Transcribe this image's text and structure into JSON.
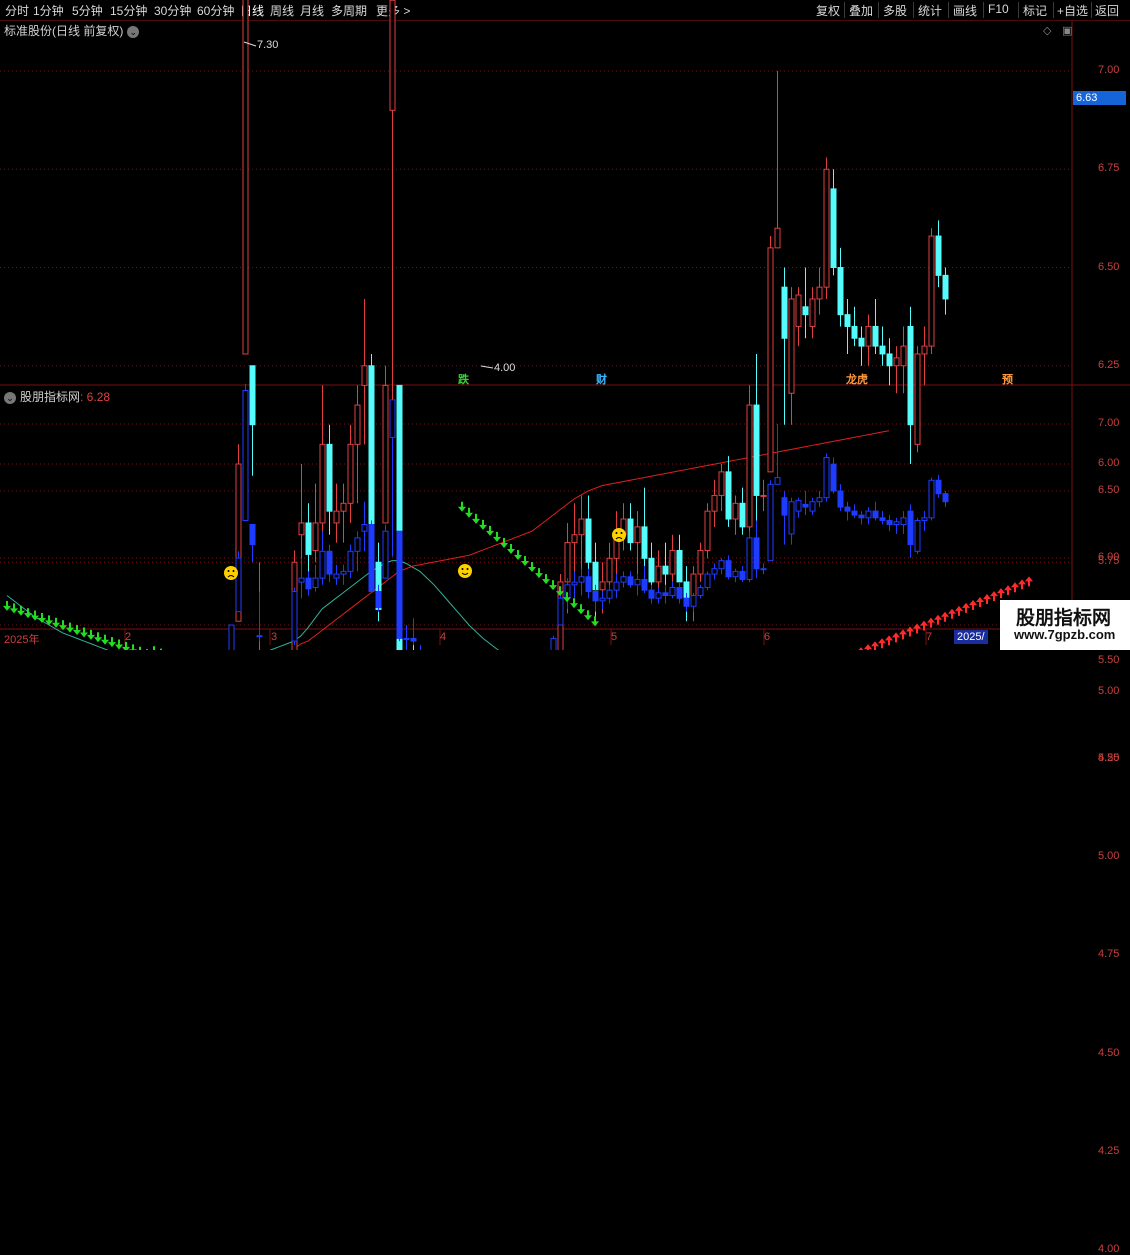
{
  "toolbar": {
    "timeframes": [
      "分时",
      "1分钟",
      "5分钟",
      "15分钟",
      "30分钟",
      "60分钟",
      "日线",
      "周线",
      "月线",
      "多周期",
      "更多 >"
    ],
    "actions": [
      "复权",
      "叠加",
      "多股",
      "统计",
      "画线",
      "F10",
      "标记",
      "+自选",
      "返回"
    ]
  },
  "main_panel": {
    "title": "标准股份(日线 前复权)",
    "current_price": "6.63",
    "high_label": "7.30",
    "low_label": "4.00",
    "y_ticks": [
      "7.00",
      "6.75",
      "6.50",
      "6.25",
      "6.00",
      "5.75",
      "5.50",
      "5.25",
      "5.00",
      "4.75",
      "4.50",
      "4.25",
      "4.00"
    ],
    "events": [
      {
        "label": "跌",
        "color": "#36d336"
      },
      {
        "label": "财",
        "color": "#39b8ff"
      },
      {
        "label": "龙虎",
        "color": "#ff9a3c"
      },
      {
        "label": "预",
        "color": "#ff9a3c"
      }
    ]
  },
  "indicator_panel": {
    "title": "股朋指标网",
    "value": ": 6.28",
    "y_ticks": [
      "7.00",
      "6.50",
      "6.00",
      "5.50",
      "5.00",
      "4.50"
    ]
  },
  "x_axis": {
    "labels": [
      "2025年",
      "2",
      "3",
      "4",
      "5",
      "6",
      "7"
    ],
    "date_tag": "2025/"
  },
  "watermark": {
    "line1": "股朋指标网",
    "line2": "www.7gpzb.com"
  },
  "colors": {
    "up": "#e14040",
    "down": "#54fcfc",
    "ind_up": "#ffff00",
    "ind_down": "#1e3cff",
    "buy_arrow": "#ff2a2a",
    "sell_arrow": "#22dd22",
    "grid": "#7a1111"
  },
  "chart_data": {
    "type": "candlestick",
    "ylim": [
      4.0,
      7.3
    ],
    "candles": [
      [
        4.55,
        4.65,
        4.45,
        4.55
      ],
      [
        4.6,
        4.7,
        4.5,
        4.62
      ],
      [
        4.6,
        4.65,
        4.45,
        4.5
      ],
      [
        4.5,
        4.75,
        4.45,
        4.7
      ],
      [
        4.68,
        4.72,
        4.55,
        4.58
      ],
      [
        4.48,
        4.62,
        4.35,
        4.45
      ],
      [
        4.52,
        4.82,
        4.48,
        4.78
      ],
      [
        4.8,
        4.92,
        4.75,
        4.88
      ],
      [
        4.9,
        4.96,
        4.82,
        4.86
      ],
      [
        4.88,
        4.95,
        4.8,
        4.92
      ],
      [
        4.84,
        4.92,
        4.8,
        4.86
      ],
      [
        4.82,
        4.98,
        4.78,
        4.96
      ],
      [
        4.95,
        5.02,
        4.85,
        4.9
      ],
      [
        4.9,
        4.98,
        4.8,
        4.82
      ],
      [
        4.82,
        4.92,
        4.72,
        4.78
      ],
      [
        4.78,
        4.98,
        4.75,
        4.95
      ],
      [
        4.92,
        4.98,
        4.8,
        4.88
      ],
      [
        4.8,
        4.86,
        4.74,
        4.8
      ],
      [
        4.84,
        4.96,
        4.8,
        4.92
      ],
      [
        4.92,
        4.99,
        4.86,
        4.95
      ],
      [
        4.98,
        5.02,
        4.92,
        4.96
      ],
      [
        4.95,
        5.04,
        4.92,
        5.02
      ],
      [
        4.98,
        5.03,
        4.96,
        5.0
      ],
      [
        5.0,
        5.1,
        4.98,
        5.08
      ],
      [
        5.08,
        5.14,
        5.0,
        5.06
      ],
      [
        5.1,
        5.12,
        5.02,
        5.05
      ],
      [
        5.04,
        5.1,
        4.98,
        5.08
      ],
      [
        5.08,
        5.12,
        4.98,
        5.0
      ],
      [
        4.98,
        5.06,
        4.96,
        5.05
      ],
      [
        5.05,
        5.1,
        4.98,
        5.02
      ],
      [
        5.02,
        5.1,
        4.98,
        5.08
      ],
      [
        5.08,
        5.12,
        4.98,
        5.0
      ],
      [
        5.0,
        5.5,
        4.98,
        5.5
      ],
      [
        5.6,
        6.05,
        5.6,
        6.0
      ],
      [
        6.28,
        7.3,
        6.28,
        7.25
      ],
      [
        6.25,
        6.1,
        5.97,
        6.1
      ],
      [
        5.42,
        5.75,
        5.38,
        5.42
      ],
      [
        5.02,
        5.08,
        4.98,
        5.06
      ],
      [
        5.0,
        5.05,
        4.98,
        5.02
      ],
      [
        5.02,
        5.12,
        5.0,
        5.1
      ],
      [
        5.1,
        5.2,
        5.05,
        5.15
      ],
      [
        5.38,
        5.78,
        5.35,
        5.75
      ],
      [
        5.82,
        6.0,
        5.7,
        5.85
      ],
      [
        5.85,
        5.9,
        5.72,
        5.77
      ],
      [
        5.78,
        5.95,
        5.75,
        5.85
      ],
      [
        5.85,
        6.2,
        5.8,
        6.05
      ],
      [
        6.05,
        6.1,
        5.82,
        5.88
      ],
      [
        5.85,
        5.95,
        5.8,
        5.88
      ],
      [
        5.88,
        5.95,
        5.8,
        5.9
      ],
      [
        5.9,
        6.1,
        5.85,
        6.05
      ],
      [
        6.05,
        6.2,
        5.9,
        6.15
      ],
      [
        6.2,
        6.42,
        6.05,
        6.25
      ],
      [
        6.25,
        6.28,
        5.75,
        5.75
      ],
      [
        5.75,
        5.8,
        5.6,
        5.63
      ],
      [
        5.85,
        6.25,
        5.85,
        6.2
      ],
      [
        6.9,
        7.18,
        6.01,
        7.18
      ],
      [
        6.2,
        6.2,
        5.38,
        5.4
      ],
      [
        5.4,
        5.5,
        5.3,
        5.4
      ],
      [
        5.4,
        5.55,
        5.35,
        5.38
      ],
      [
        5.3,
        5.35,
        5.25,
        5.27
      ],
      [
        4.85,
        4.9,
        4.7,
        4.78
      ],
      [
        4.6,
        4.65,
        4.0,
        4.46
      ],
      [
        4.45,
        4.65,
        4.42,
        4.6
      ],
      [
        4.58,
        4.82,
        4.55,
        4.8
      ],
      [
        4.8,
        4.9,
        4.72,
        4.85
      ],
      [
        4.88,
        5.0,
        4.85,
        4.98
      ],
      [
        4.95,
        5.05,
        4.9,
        5.0
      ],
      [
        5.0,
        5.05,
        4.92,
        4.98
      ],
      [
        4.95,
        5.02,
        4.85,
        4.9
      ],
      [
        4.85,
        4.95,
        4.75,
        4.88
      ],
      [
        4.88,
        4.98,
        4.82,
        4.95
      ],
      [
        4.95,
        5.05,
        4.9,
        5.0
      ],
      [
        5.0,
        5.08,
        4.95,
        5.02
      ],
      [
        5.02,
        5.08,
        4.95,
        5.0
      ],
      [
        5.0,
        5.05,
        4.95,
        4.98
      ],
      [
        4.98,
        5.02,
        4.92,
        5.0
      ],
      [
        5.0,
        5.08,
        4.98,
        5.05
      ],
      [
        5.05,
        5.25,
        5.02,
        5.2
      ],
      [
        5.2,
        5.42,
        5.18,
        5.4
      ],
      [
        5.5,
        5.72,
        5.5,
        5.7
      ],
      [
        5.7,
        5.85,
        5.62,
        5.8
      ],
      [
        5.8,
        5.9,
        5.7,
        5.82
      ],
      [
        5.82,
        5.92,
        5.72,
        5.86
      ],
      [
        5.86,
        5.92,
        5.7,
        5.75
      ],
      [
        5.75,
        5.8,
        5.6,
        5.68
      ],
      [
        5.68,
        5.75,
        5.62,
        5.7
      ],
      [
        5.7,
        5.8,
        5.66,
        5.76
      ],
      [
        5.76,
        5.88,
        5.7,
        5.82
      ],
      [
        5.82,
        5.9,
        5.78,
        5.86
      ],
      [
        5.86,
        5.9,
        5.78,
        5.8
      ],
      [
        5.8,
        5.88,
        5.72,
        5.84
      ],
      [
        5.84,
        5.94,
        5.74,
        5.76
      ],
      [
        5.76,
        5.8,
        5.66,
        5.7
      ],
      [
        5.7,
        5.78,
        5.66,
        5.74
      ],
      [
        5.74,
        5.8,
        5.66,
        5.72
      ],
      [
        5.72,
        5.82,
        5.7,
        5.78
      ],
      [
        5.78,
        5.82,
        5.66,
        5.7
      ],
      [
        5.7,
        5.74,
        5.6,
        5.64
      ],
      [
        5.64,
        5.74,
        5.6,
        5.72
      ],
      [
        5.72,
        5.8,
        5.7,
        5.78
      ],
      [
        5.78,
        5.9,
        5.76,
        5.88
      ],
      [
        5.88,
        5.96,
        5.84,
        5.92
      ],
      [
        5.92,
        6.0,
        5.88,
        5.98
      ],
      [
        5.98,
        6.02,
        5.84,
        5.86
      ],
      [
        5.86,
        5.92,
        5.82,
        5.9
      ],
      [
        5.9,
        5.94,
        5.82,
        5.84
      ],
      [
        5.84,
        6.2,
        5.82,
        6.15
      ],
      [
        6.15,
        6.28,
        5.85,
        5.92
      ],
      [
        5.92,
        5.96,
        5.88,
        5.92
      ],
      [
        5.98,
        6.58,
        5.98,
        6.55
      ],
      [
        6.55,
        7.0,
        6.55,
        6.6
      ],
      [
        6.45,
        6.5,
        6.1,
        6.32
      ],
      [
        6.18,
        6.45,
        6.1,
        6.42
      ],
      [
        6.35,
        6.45,
        6.3,
        6.43
      ],
      [
        6.4,
        6.5,
        6.32,
        6.38
      ],
      [
        6.35,
        6.45,
        6.32,
        6.42
      ],
      [
        6.42,
        6.5,
        6.38,
        6.45
      ],
      [
        6.45,
        6.78,
        6.42,
        6.75
      ],
      [
        6.7,
        6.75,
        6.48,
        6.5
      ],
      [
        6.5,
        6.55,
        6.35,
        6.38
      ],
      [
        6.38,
        6.42,
        6.28,
        6.35
      ],
      [
        6.35,
        6.4,
        6.3,
        6.32
      ],
      [
        6.32,
        6.35,
        6.25,
        6.3
      ],
      [
        6.3,
        6.38,
        6.25,
        6.35
      ],
      [
        6.35,
        6.42,
        6.28,
        6.3
      ],
      [
        6.3,
        6.35,
        6.25,
        6.28
      ],
      [
        6.28,
        6.32,
        6.2,
        6.25
      ],
      [
        6.25,
        6.3,
        6.18,
        6.27
      ],
      [
        6.25,
        6.35,
        6.18,
        6.3
      ],
      [
        6.35,
        6.4,
        6.0,
        6.1
      ],
      [
        6.05,
        6.3,
        6.03,
        6.28
      ],
      [
        6.28,
        6.35,
        6.2,
        6.3
      ],
      [
        6.3,
        6.6,
        6.28,
        6.58
      ],
      [
        6.58,
        6.62,
        6.45,
        6.48
      ],
      [
        6.48,
        6.5,
        6.38,
        6.42
      ]
    ],
    "ma_upper": [
      5.72,
      5.68,
      5.64,
      5.6,
      5.56,
      5.53,
      5.5,
      5.47,
      5.44,
      5.42,
      5.4,
      5.38,
      5.36,
      5.34,
      5.32,
      5.3,
      5.28,
      5.26,
      5.24,
      5.22,
      5.2,
      5.18,
      5.16,
      5.14,
      5.12,
      5.1,
      5.08,
      5.07,
      5.06,
      5.05,
      5.04,
      5.04,
      5.05,
      5.1,
      5.18,
      5.25,
      5.28,
      5.3,
      5.32,
      5.34,
      5.36,
      5.38,
      5.42,
      5.48,
      5.55,
      5.62,
      5.66,
      5.7,
      5.74,
      5.78,
      5.82,
      5.86,
      5.9,
      5.93,
      5.96,
      5.98,
      5.98,
      5.96,
      5.93,
      5.9,
      5.85,
      5.8,
      5.74,
      5.68,
      5.62,
      5.56,
      5.5,
      5.45,
      5.4,
      5.36,
      5.32,
      5.28,
      5.24,
      5.2,
      5.16,
      5.14,
      5.12,
      5.12
    ],
    "ma_lower": [
      4.7,
      4.72,
      4.74,
      4.76,
      4.77,
      4.78,
      4.79,
      4.8,
      4.81,
      4.82,
      4.83,
      4.84,
      4.85,
      4.86,
      4.87,
      4.88,
      4.89,
      4.9,
      4.9,
      4.91,
      4.92,
      4.92,
      4.93,
      4.94,
      4.94,
      4.95,
      4.96,
      4.96,
      4.97,
      4.98,
      4.99,
      5.0,
      5.02,
      5.06,
      5.1,
      5.12,
      5.14,
      5.16,
      5.2,
      5.24,
      5.28,
      5.32,
      5.36,
      5.38,
      5.42,
      5.46,
      5.5,
      5.54,
      5.58,
      5.62,
      5.66,
      5.7,
      5.74,
      5.78,
      5.82,
      5.86,
      5.9,
      5.92,
      5.94,
      5.95,
      5.96,
      5.97,
      5.98,
      5.99,
      6.0,
      6.01,
      6.02,
      6.04,
      6.06,
      6.08,
      6.1,
      6.12,
      6.14,
      6.16,
      6.18,
      6.2,
      6.24,
      6.28,
      6.32,
      6.36,
      6.4,
      6.44,
      6.47,
      6.5,
      6.52,
      6.54,
      6.55,
      6.56,
      6.57,
      6.58,
      6.59,
      6.6,
      6.61,
      6.62,
      6.63,
      6.64,
      6.65,
      6.66,
      6.67,
      6.68,
      6.69,
      6.7,
      6.71,
      6.72,
      6.73,
      6.74,
      6.75,
      6.76,
      6.77,
      6.78,
      6.79,
      6.8,
      6.81,
      6.82,
      6.83,
      6.84,
      6.85,
      6.86,
      6.87,
      6.88,
      6.89,
      6.9,
      6.91,
      6.92,
      6.93,
      6.94,
      6.95
    ]
  }
}
